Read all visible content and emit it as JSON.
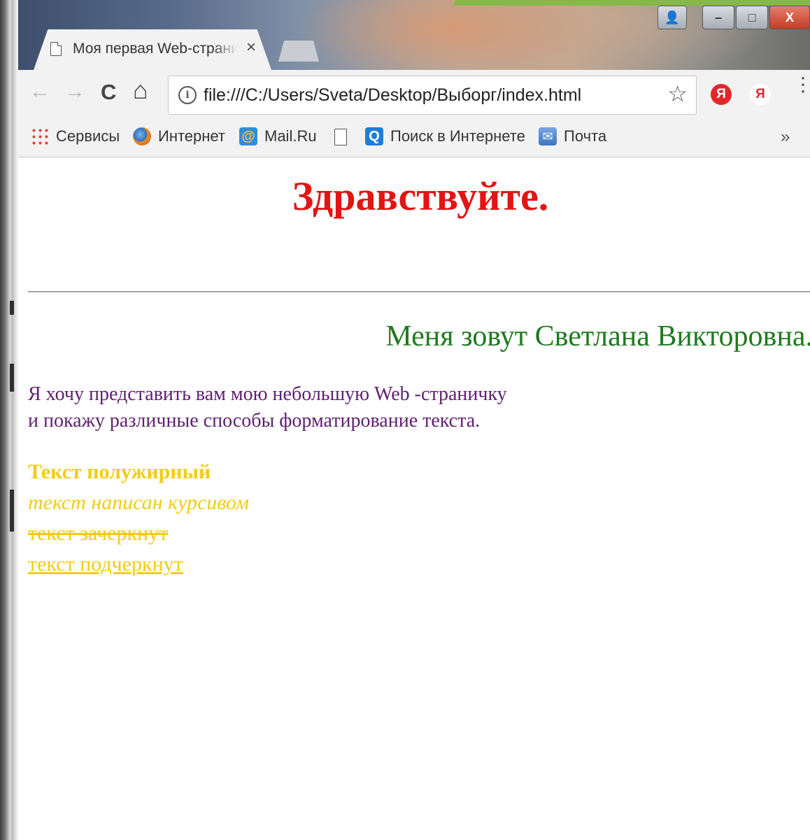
{
  "browser": {
    "tab_title": "Моя первая Web-страни",
    "tab_close": "×",
    "url": "file:///C:/Users/Sveta/Desktop/Выборг/index.html",
    "nav": {
      "back": "←",
      "forward": "→",
      "reload": "C",
      "home": "⌂"
    },
    "star": "☆",
    "extensions": [
      "Я",
      "Я"
    ],
    "menu": "⋮"
  },
  "window_controls": {
    "user": "👤",
    "minimize": "–",
    "maximize": "□",
    "close": "X"
  },
  "bookmarks": [
    {
      "label": "Сервисы",
      "icon": "apps-grid-icon"
    },
    {
      "label": "Интернет",
      "icon": "globe-icon"
    },
    {
      "label": "Mail.Ru",
      "icon": "mail-ru-icon"
    },
    {
      "label": "",
      "icon": "document-icon"
    },
    {
      "label": "Поиск в Интернете",
      "icon": "search-icon"
    },
    {
      "label": "Почта",
      "icon": "mail-envelope-icon"
    }
  ],
  "bookmarks_more": "»",
  "page": {
    "heading": "Здравствуйте.",
    "name_line": "Меня зовут Светлана Викторовна.",
    "intro_line1": "Я хочу представить вам мою небольшую Web -страничку",
    "intro_line2": "и покажу различные способы форматирование текста.",
    "bold_text": "Текст полужирный",
    "italic_text": "текст написан курсивом",
    "strike_text": "текст зачеркнут ",
    "underline_text": "текст подчеркнут "
  },
  "colors": {
    "heading": "#e31414",
    "name": "#1f7a1f",
    "intro": "#5f2070",
    "formatting": "#f2cc14"
  }
}
